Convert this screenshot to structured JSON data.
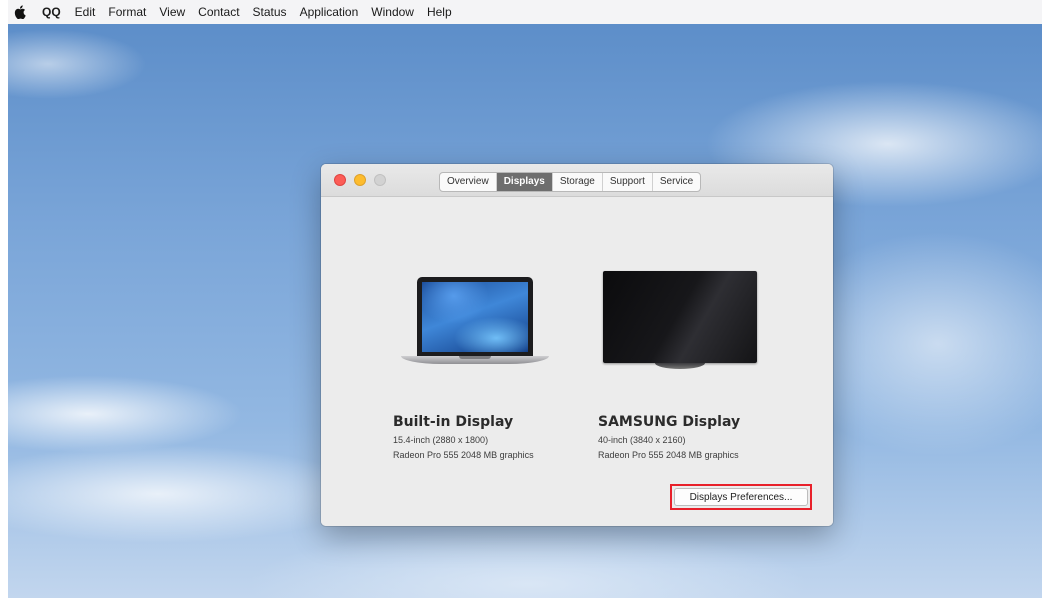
{
  "menubar": {
    "apple_icon": "apple-logo-icon",
    "app_name": "QQ",
    "items": [
      "Edit",
      "Format",
      "View",
      "Contact",
      "Status",
      "Application",
      "Window",
      "Help"
    ]
  },
  "window": {
    "tabs": [
      {
        "label": "Overview",
        "active": false
      },
      {
        "label": "Displays",
        "active": true
      },
      {
        "label": "Storage",
        "active": false
      },
      {
        "label": "Support",
        "active": false
      },
      {
        "label": "Service",
        "active": false
      }
    ],
    "displays": [
      {
        "name": "Built-in Display",
        "size": "15.4-inch (2880 x 1800)",
        "graphics": "Radeon Pro 555 2048 MB graphics",
        "icon": "laptop-icon"
      },
      {
        "name": "SAMSUNG Display",
        "size": "40-inch (3840 x 2160)",
        "graphics": "Radeon Pro 555 2048 MB graphics",
        "icon": "monitor-icon"
      }
    ],
    "preferences_button": "Displays Preferences..."
  },
  "colors": {
    "highlight_border": "#e8202a",
    "active_tab": "#6e6e6e",
    "close": "#fc5d57",
    "minimize": "#fdbc2e",
    "zoom_inactive": "#d2d2d2"
  }
}
